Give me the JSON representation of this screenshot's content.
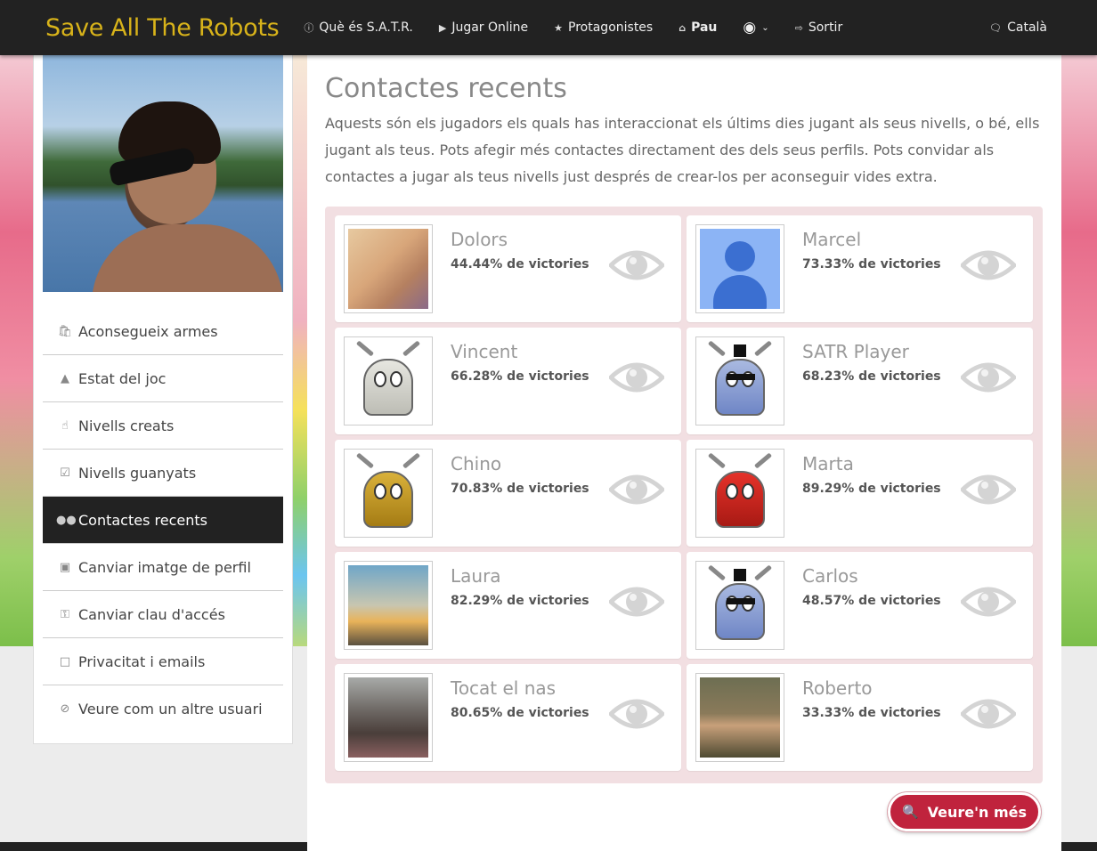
{
  "brand": "Save All The Robots",
  "nav": {
    "about": "Què és S.A.T.R.",
    "play": "Jugar Online",
    "heroes": "Protagonistes",
    "user": "Pau",
    "logout": "Sortir",
    "language": "Català"
  },
  "sidebar": {
    "items": [
      {
        "label": "Aconsegueix armes",
        "icon": "shopping-bag-icon"
      },
      {
        "label": "Estat del joc",
        "icon": "area-chart-icon"
      },
      {
        "label": "Nivells creats",
        "icon": "hand-pointer-icon"
      },
      {
        "label": "Nivells guanyats",
        "icon": "check-square-icon"
      },
      {
        "label": "Contactes recents",
        "icon": "users-icon",
        "active": true
      },
      {
        "label": "Canviar imatge de perfil",
        "icon": "image-icon"
      },
      {
        "label": "Canviar clau d'accés",
        "icon": "key-icon"
      },
      {
        "label": "Privacitat i emails",
        "icon": "note-icon"
      },
      {
        "label": "Veure com un altre usuari",
        "icon": "eye-slash-icon"
      }
    ]
  },
  "main": {
    "title": "Contactes recents",
    "intro": "Aquests són els jugadors els quals has interaccionat els últims dies jugant als seus nivells, o bé, ells jugant als teus. Pots afegir més contactes directament des dels seus perfils. Pots convidar als contactes a jugar als teus nivells just després de crear-los per aconseguir vides extra.",
    "stat_suffix": " de victories",
    "contacts": [
      {
        "name": "Dolors",
        "pct": "44.44%",
        "avatar": "photo"
      },
      {
        "name": "Marcel",
        "pct": "73.33%",
        "avatar": "default"
      },
      {
        "name": "Vincent",
        "pct": "66.28%",
        "avatar": "robot-grey"
      },
      {
        "name": "SATR Player",
        "pct": "68.23%",
        "avatar": "robot-blue"
      },
      {
        "name": "Chino",
        "pct": "70.83%",
        "avatar": "robot-gold"
      },
      {
        "name": "Marta",
        "pct": "89.29%",
        "avatar": "robot-red"
      },
      {
        "name": "Laura",
        "pct": "82.29%",
        "avatar": "photo-sunset"
      },
      {
        "name": "Carlos",
        "pct": "48.57%",
        "avatar": "robot-blue"
      },
      {
        "name": "Tocat el nas",
        "pct": "80.65%",
        "avatar": "photo-street"
      },
      {
        "name": "Roberto",
        "pct": "33.33%",
        "avatar": "photo-man"
      }
    ],
    "more_button": "Veure'n més"
  },
  "colors": {
    "brand": "#d8b31a",
    "navbar": "#222222",
    "accent": "#c0233d",
    "grid_bg": "#f2dfe2"
  }
}
